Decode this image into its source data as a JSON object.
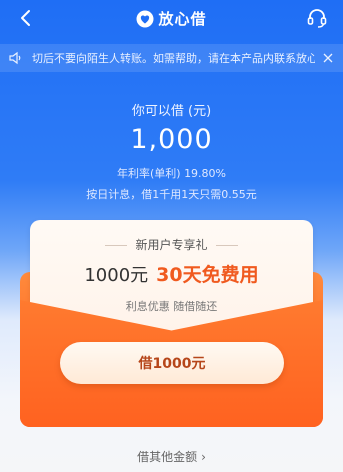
{
  "header": {
    "brand_name": "放心借",
    "icons": {
      "back": "chevron-left-icon",
      "brand": "heart-logo-icon",
      "service": "headset-icon"
    }
  },
  "notice": {
    "text": "切后不要向陌生人转账。如需帮助，请在本产品内联系放心",
    "icons": {
      "speaker": "speaker-icon",
      "close": "close-icon"
    }
  },
  "loan": {
    "label": "你可以借 (元)",
    "amount": "1,000",
    "rate": "年利率(单利) 19.80%",
    "rule": "按日计息，借1千用1天只需0.55元"
  },
  "promo": {
    "title": "新用户专享礼",
    "amount_text": "1000元",
    "highlight": "30天免费用",
    "sub": "利息优惠  随借随还",
    "button": "借1000元"
  },
  "footer": {
    "other_amount": "借其他金额"
  },
  "colors": {
    "primary": "#1f6ef5",
    "accent": "#f05a1f",
    "envelope": "#ff6a24"
  }
}
